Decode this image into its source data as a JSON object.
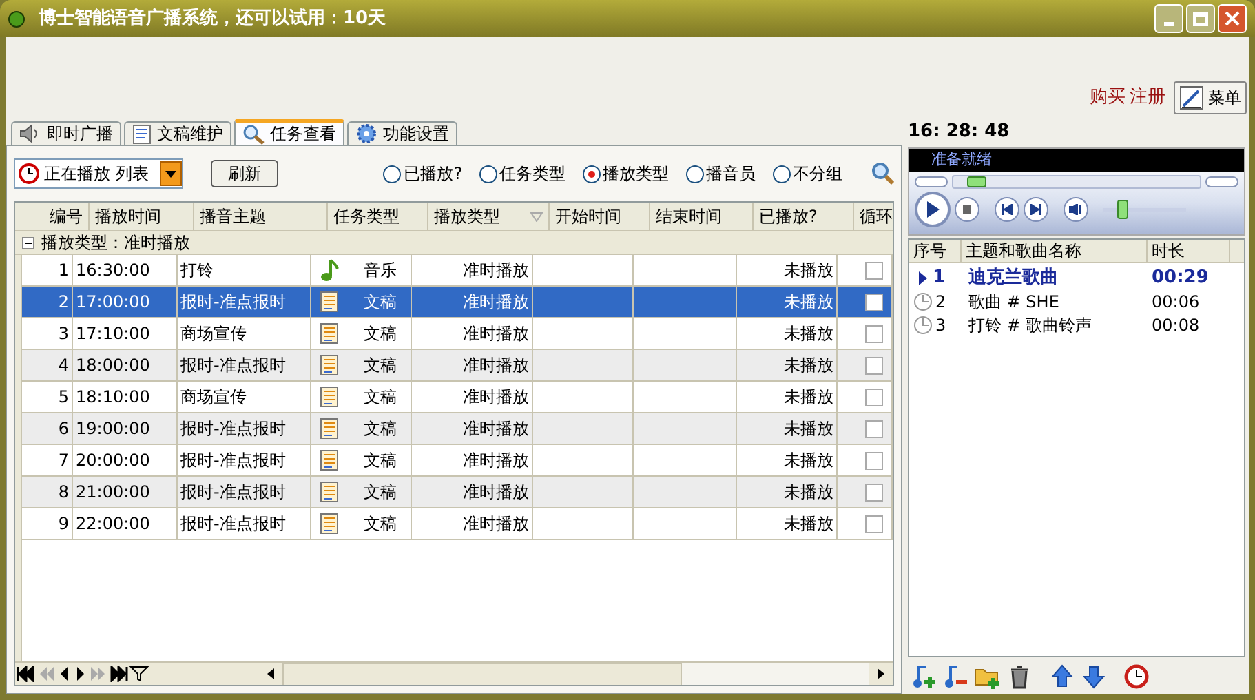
{
  "window": {
    "title": "博士智能语音广播系统，还可以试用：10天"
  },
  "header": {
    "links": [
      "购买",
      "注册"
    ],
    "menu_button": "菜单"
  },
  "tabs": [
    {
      "label": "即时广播",
      "kind": "speaker",
      "selected": false
    },
    {
      "label": "文稿维护",
      "kind": "document",
      "selected": false
    },
    {
      "label": "任务查看",
      "kind": "magnifier",
      "selected": true
    },
    {
      "label": "功能设置",
      "kind": "gear",
      "selected": false
    }
  ],
  "toolbar": {
    "dropdown": "正在播放 列表",
    "refresh_button": "刷新",
    "radios": [
      {
        "label": "已播放?",
        "selected": false
      },
      {
        "label": "任务类型",
        "selected": false
      },
      {
        "label": "播放类型",
        "selected": true
      },
      {
        "label": "播音员",
        "selected": false
      },
      {
        "label": "不分组",
        "selected": false
      }
    ]
  },
  "table": {
    "columns": [
      {
        "label": "编号",
        "sorted": false
      },
      {
        "label": "播放时间",
        "sorted": false
      },
      {
        "label": "播音主题",
        "sorted": false
      },
      {
        "label": "任务类型",
        "sorted": false
      },
      {
        "label": "播放类型",
        "sorted": true
      },
      {
        "label": "开始时间",
        "sorted": false
      },
      {
        "label": "结束时间",
        "sorted": false
      },
      {
        "label": "已播放?",
        "sorted": false
      },
      {
        "label": "循环",
        "sorted": false
      }
    ],
    "group": {
      "label": "播放类型：准时播放",
      "expanded": true
    },
    "rows": [
      {
        "no": "1",
        "time": "16:30:00",
        "topic": "打铃",
        "kind": "music",
        "task_type": "音乐",
        "play_type": "准时播放",
        "played": "未播放",
        "checked": false,
        "selected": false
      },
      {
        "no": "2",
        "time": "17:00:00",
        "topic": "报时-准点报时",
        "kind": "document",
        "task_type": "文稿",
        "play_type": "准时播放",
        "played": "未播放",
        "checked": false,
        "selected": true
      },
      {
        "no": "3",
        "time": "17:10:00",
        "topic": "商场宣传",
        "kind": "document",
        "task_type": "文稿",
        "play_type": "准时播放",
        "played": "未播放",
        "checked": false,
        "selected": false
      },
      {
        "no": "4",
        "time": "18:00:00",
        "topic": "报时-准点报时",
        "kind": "document",
        "task_type": "文稿",
        "play_type": "准时播放",
        "played": "未播放",
        "checked": false,
        "selected": false
      },
      {
        "no": "5",
        "time": "18:10:00",
        "topic": "商场宣传",
        "kind": "document",
        "task_type": "文稿",
        "play_type": "准时播放",
        "played": "未播放",
        "checked": false,
        "selected": false
      },
      {
        "no": "6",
        "time": "19:00:00",
        "topic": "报时-准点报时",
        "kind": "document",
        "task_type": "文稿",
        "play_type": "准时播放",
        "played": "未播放",
        "checked": false,
        "selected": false
      },
      {
        "no": "7",
        "time": "20:00:00",
        "topic": "报时-准点报时",
        "kind": "document",
        "task_type": "文稿",
        "play_type": "准时播放",
        "played": "未播放",
        "checked": false,
        "selected": false
      },
      {
        "no": "8",
        "time": "21:00:00",
        "topic": "报时-准点报时",
        "kind": "document",
        "task_type": "文稿",
        "play_type": "准时播放",
        "played": "未播放",
        "checked": false,
        "selected": false
      },
      {
        "no": "9",
        "time": "22:00:00",
        "topic": "报时-准点报时",
        "kind": "document",
        "task_type": "文稿",
        "play_type": "准时播放",
        "played": "未播放",
        "checked": false,
        "selected": false
      }
    ]
  },
  "player": {
    "clock": "16: 28: 48",
    "status": "准备就绪",
    "seek": {
      "level": 0.06
    },
    "volume": {
      "level": 0.2
    }
  },
  "playlist": {
    "columns": [
      "序号",
      "主题和歌曲名称",
      "时长"
    ],
    "items": [
      {
        "index": "1",
        "title": "迪克兰歌曲",
        "duration": "00:29",
        "playing": true
      },
      {
        "index": "2",
        "title": "歌曲 # SHE",
        "duration": "00:06",
        "playing": false
      },
      {
        "index": "3",
        "title": "打铃 # 歌曲铃声",
        "duration": "00:08",
        "playing": false
      }
    ]
  }
}
